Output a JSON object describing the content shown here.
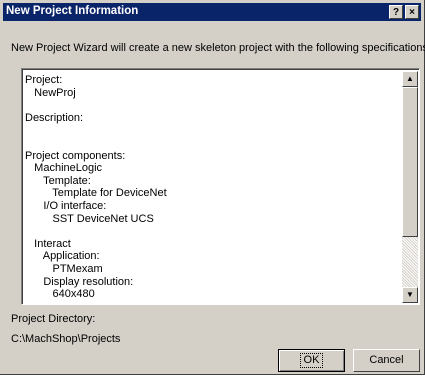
{
  "window": {
    "title": "New Project Information",
    "help_glyph": "?",
    "close_glyph": "×"
  },
  "intro_text": "New Project Wizard will create a new skeleton project with the following specifications:",
  "summary_lines": [
    "Project:",
    "   NewProj",
    "",
    "Description:",
    "",
    "",
    "Project components:",
    "   MachineLogic",
    "      Template:",
    "         Template for DeviceNet",
    "      I/O interface:",
    "         SST DeviceNet UCS",
    "",
    "   Interact",
    "      Application:",
    "         PTMexam",
    "      Display resolution:",
    "         640x480"
  ],
  "project_directory": {
    "label": "Project Directory:",
    "value": "C:\\MachShop\\Projects"
  },
  "buttons": {
    "ok": "OK",
    "cancel": "Cancel"
  },
  "icons": {
    "scroll_up": "▲",
    "scroll_down": "▼"
  }
}
